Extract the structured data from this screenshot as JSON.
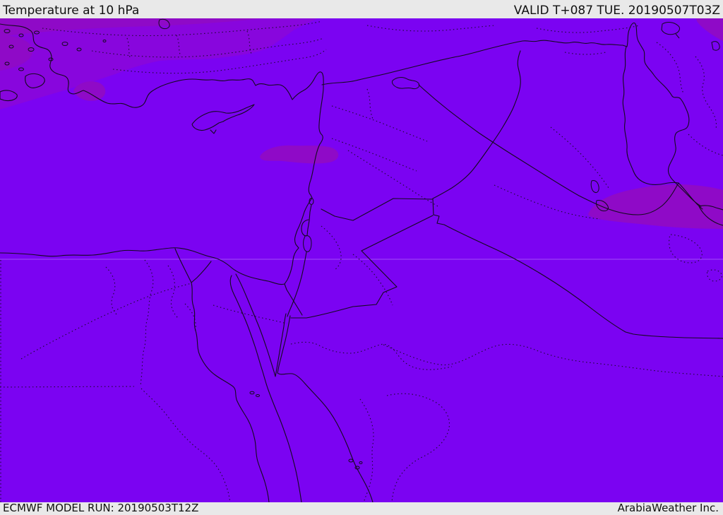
{
  "header": {
    "title": "Temperature at 10 hPa",
    "valid_label": "VALID T+087 TUE. 20190507T03Z"
  },
  "footer": {
    "model_run": "ECMWF MODEL RUN: 20190503T12Z",
    "brand": "ArabiaWeather Inc."
  },
  "map": {
    "region": "Eastern Mediterranean / Middle East",
    "legend_note": "uniform violet temperature field with slightly cooler darker purple bands in north and patches over Lebanon, NE Iraq and map corners"
  },
  "colors": {
    "bar_bg": "#e9e9e9",
    "bar_text": "#111111",
    "violet_main": "#7b03f2",
    "violet_upper": "#8806dd",
    "violet_patch": "#8f0ac7",
    "line": "#140a1e",
    "graticule": "rgba(240,235,255,0.32)"
  }
}
